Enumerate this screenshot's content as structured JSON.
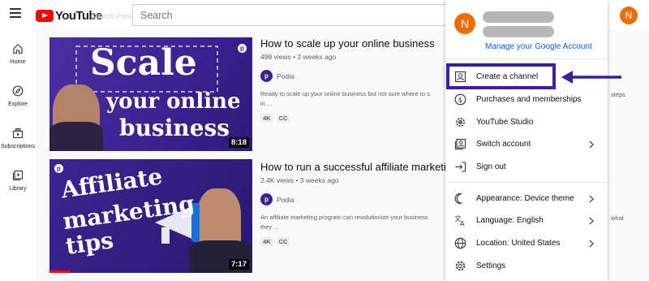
{
  "header": {
    "logo_text": "YouTube",
    "ghost_text": "Search Podia",
    "search_placeholder": "Search",
    "avatar_letter": "N"
  },
  "sidebar": {
    "items": [
      {
        "label": "Home",
        "icon": "home-icon"
      },
      {
        "label": "Explore",
        "icon": "compass-icon"
      },
      {
        "label": "Subscriptions",
        "icon": "subscriptions-icon"
      },
      {
        "label": "Library",
        "icon": "library-icon"
      }
    ]
  },
  "videos": [
    {
      "thumb_lines": [
        "Scale",
        "your online",
        "business"
      ],
      "duration": "8:18",
      "title": "How to scale up your online business",
      "stats": "498 views • 2 weeks ago",
      "channel": "Podia",
      "channel_initial": "p",
      "description": "Ready to scale up your online business but not sure where to s",
      "description_line2": "in ...",
      "description_tail": "steps",
      "tags": [
        "4K",
        "CC"
      ]
    },
    {
      "thumb_lines": [
        "Affiliate",
        "marketing",
        "tips"
      ],
      "duration": "7:17",
      "title": "How to run a successful affiliate marketin",
      "stats": "2.4K views • 3 weeks ago",
      "channel": "Podia",
      "channel_initial": "p",
      "description": "An affiliate marketing program can revolutionize your business",
      "description_line2": "they ...",
      "description_tail": "what",
      "tags": [
        "4K",
        "CC"
      ],
      "watched_fraction": 0.1
    }
  ],
  "account_menu": {
    "avatar_letter": "N",
    "manage_link": "Manage your Google Account",
    "items": [
      {
        "label": "Create a channel",
        "icon": "person-box-icon"
      },
      {
        "label": "Purchases and memberships",
        "icon": "dollar-circle-icon"
      },
      {
        "label": "YouTube Studio",
        "icon": "gear-icon"
      },
      {
        "label": "Switch account",
        "icon": "switch-account-icon",
        "chevron": true
      },
      {
        "label": "Sign out",
        "icon": "sign-out-icon"
      },
      {
        "label": "Appearance: Device theme",
        "icon": "moon-icon",
        "chevron": true
      },
      {
        "label": "Language: English",
        "icon": "translate-icon",
        "chevron": true
      },
      {
        "label": "Location: United States",
        "icon": "globe-icon",
        "chevron": true
      },
      {
        "label": "Settings",
        "icon": "settings-icon"
      }
    ],
    "highlighted_item": "Create a channel"
  },
  "colors": {
    "brand_red": "#ff0000",
    "avatar_orange": "#ef6c00",
    "link_blue": "#065fd4",
    "highlight_purple": "#3a1fa0",
    "podia_purple": "#3a2290"
  }
}
